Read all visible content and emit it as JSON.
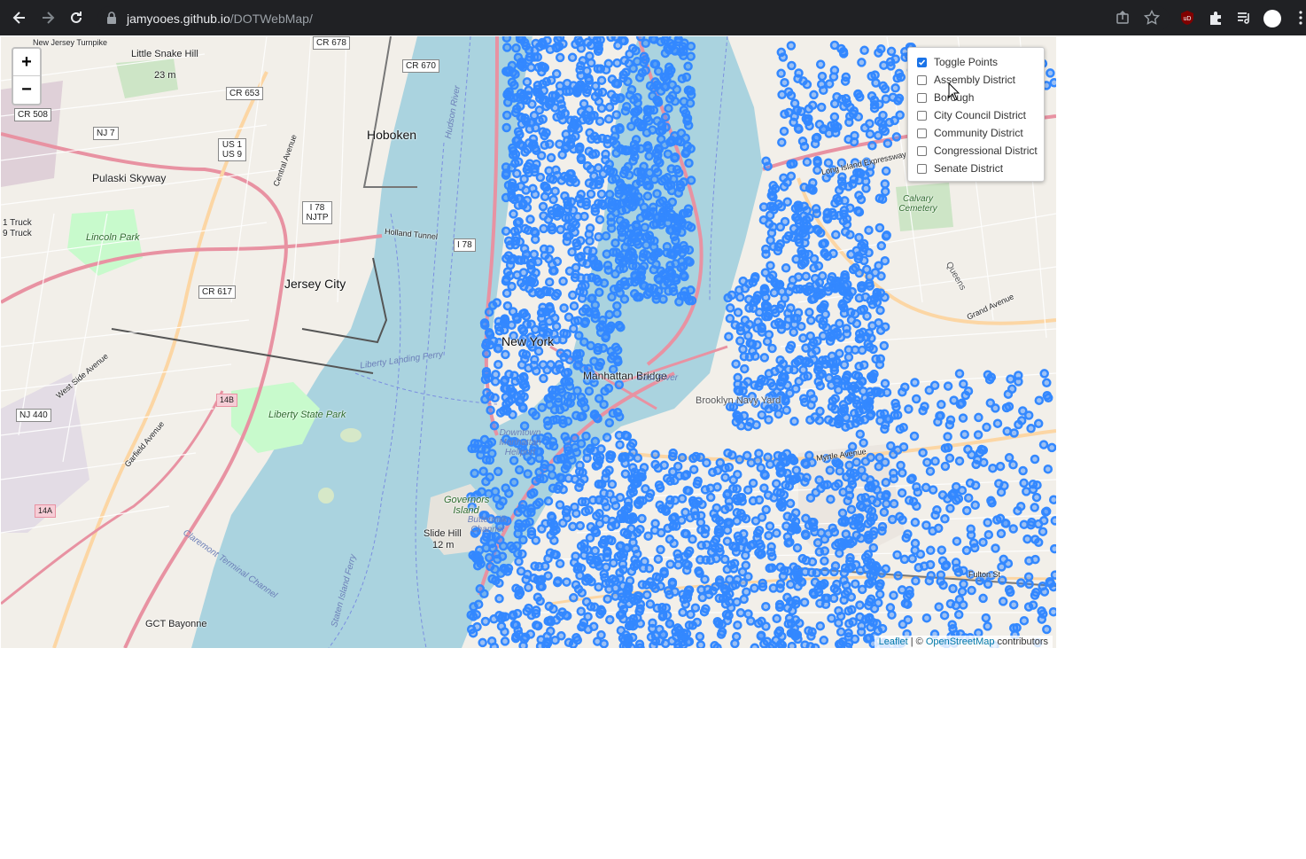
{
  "browser": {
    "url_host": "jamyooes.github.io",
    "url_path": "/DOTWebMap/"
  },
  "map": {
    "zoom_in": "+",
    "zoom_out": "−",
    "point_color": "#3388ff",
    "labels": {
      "new_jersey_turnpike": "New Jersey Turnpike",
      "little_snake_hill": "Little Snake Hill",
      "elev_23": "23 m",
      "hoboken": "Hoboken",
      "pulaski_skyway": "Pulaski Skyway",
      "lincoln_park": "Lincoln Park",
      "jersey_city": "Jersey City",
      "holland_tunnel": "Holland Tunnel",
      "liberty_state_park": "Liberty State Park",
      "manhattan_bridge": "Manhattan Bridge",
      "new_york": "New York",
      "brooklyn_navy_yard": "Brooklyn Navy Yard",
      "downtown_heliport": "Downtown Manhattan Heliport",
      "governors_island": "Governors Island",
      "buttermilk_channel": "Buttermilk Channel",
      "slide_hill": "Slide Hill",
      "elev_12": "12 m",
      "gct_bayonne": "GCT Bayonne",
      "calvary_cemetery": "Calvary Cemetery",
      "east_river": "East River",
      "west_side_avenue": "West Side Avenue",
      "garfield_avenue": "Garfield Avenue",
      "central_avenue": "Central Avenue",
      "queens": "Queens",
      "grand_avenue": "Grand Avenue",
      "myrtle_avenue": "Myrtle Avenue",
      "fulton_st": "Fulton St",
      "long_island_expressway": "Long Island Expressway",
      "claremont_channel": "Claremont Terminal Channel",
      "staten_island_ferry": "Staten Island Ferry",
      "hudson_river": "Hudson River",
      "liberty_landing_ferry": "Liberty Landing Ferry",
      "one_truck": "1 Truck",
      "nine_truck": "9 Truck"
    },
    "shields": {
      "cr678": "CR 678",
      "cr670": "CR 670",
      "cr653": "CR 653",
      "cr508": "CR 508",
      "nj7": "NJ 7",
      "us1": "US 1",
      "us9": "US 9",
      "i78": "I 78",
      "njtp": "NJTP",
      "i78b": "I 78",
      "cr617": "CR 617",
      "nj440": "NJ 440",
      "exit14b": "14B",
      "exit14a": "14A"
    }
  },
  "layers": {
    "items": [
      {
        "label": "Toggle Points",
        "checked": true
      },
      {
        "label": "Assembly District",
        "checked": false
      },
      {
        "label": "Borough",
        "checked": false
      },
      {
        "label": "City Council District",
        "checked": false
      },
      {
        "label": "Community District",
        "checked": false
      },
      {
        "label": "Congressional District",
        "checked": false
      },
      {
        "label": "Senate District",
        "checked": false
      }
    ]
  },
  "attribution": {
    "leaflet": "Leaflet",
    "sep": " | © ",
    "osm": "OpenStreetMap",
    "contributors": " contributors"
  }
}
